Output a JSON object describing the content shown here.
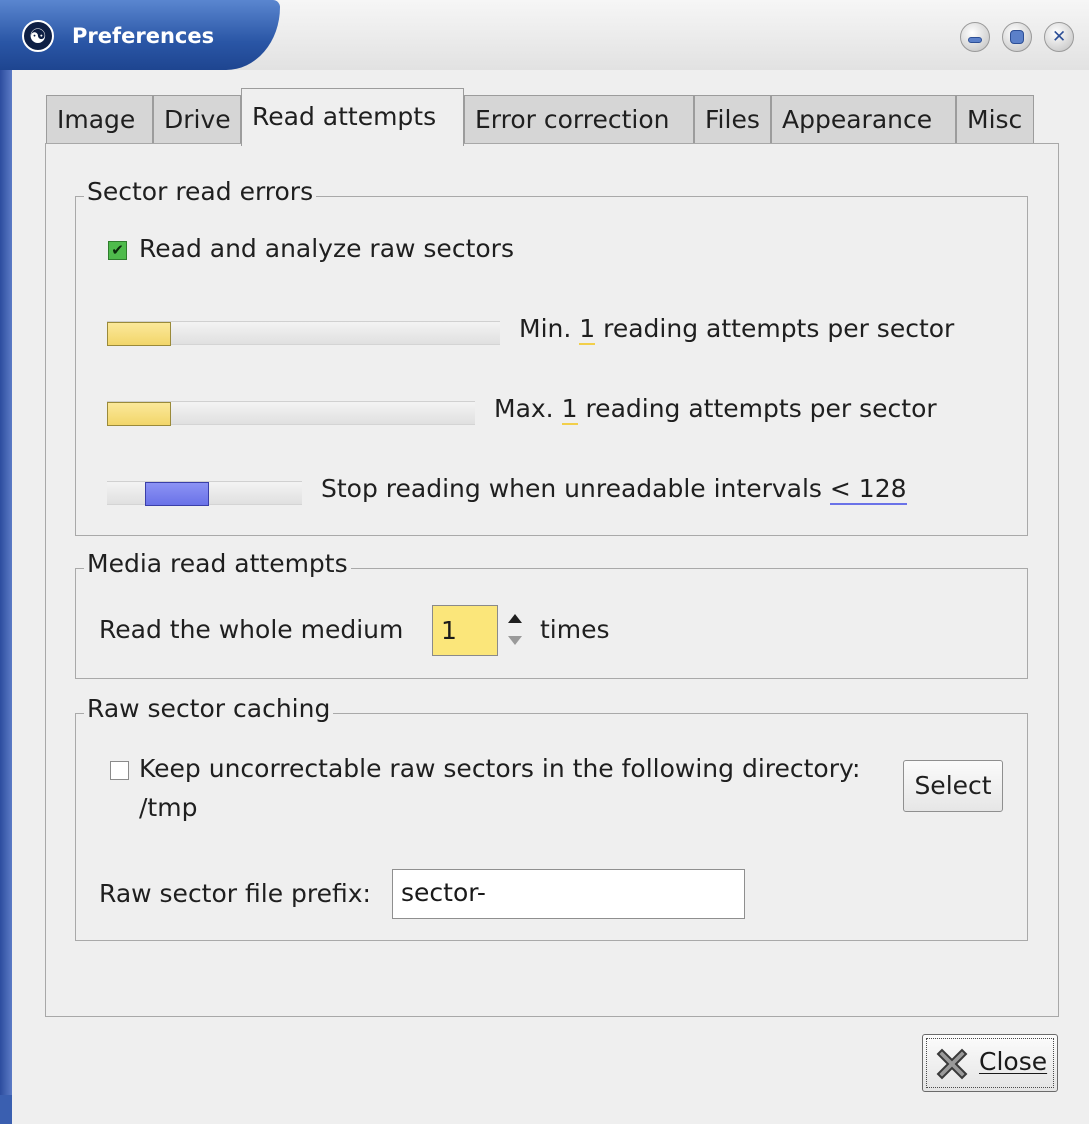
{
  "window": {
    "title": "Preferences",
    "app_icon_glyph": "☯",
    "controls": [
      "minimize-icon",
      "maximize-icon",
      "close-icon"
    ]
  },
  "tabs": [
    {
      "label": "Image"
    },
    {
      "label": "Drive"
    },
    {
      "label": "Read attempts",
      "active": true
    },
    {
      "label": "Error correction"
    },
    {
      "label": "Files"
    },
    {
      "label": "Appearance"
    },
    {
      "label": "Misc"
    }
  ],
  "sector_read_errors": {
    "title": "Sector read errors",
    "raw_sectors_label": "Read and analyze raw sectors",
    "raw_sectors_checked": true,
    "min_prefix": "Min.",
    "min_value": "1",
    "min_suffix": "reading attempts per sector",
    "max_prefix": "Max.",
    "max_value": "1",
    "max_suffix": "reading attempts per sector",
    "stop_prefix": "Stop reading when unreadable intervals",
    "stop_value": "< 128"
  },
  "media_read_attempts": {
    "title": "Media read attempts",
    "prefix": "Read the whole medium",
    "value": "1",
    "suffix": "times"
  },
  "raw_sector_caching": {
    "title": "Raw sector caching",
    "keep_label": "Keep uncorrectable raw sectors in the following directory:",
    "keep_checked": false,
    "directory": "/tmp",
    "select_label": "Select",
    "prefix_label": "Raw sector file prefix:",
    "prefix_value": "sector-"
  },
  "footer": {
    "close_label": "Close"
  },
  "colors": {
    "titlebar": "#2a56a6",
    "slider_yellow": "#f2d66a",
    "slider_blue": "#6a72e8",
    "checkbox_green": "#4fbb4c",
    "spin_yellow": "#fbe67a"
  }
}
